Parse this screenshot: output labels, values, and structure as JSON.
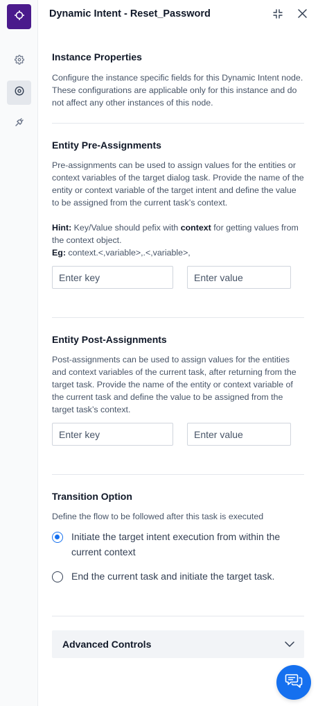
{
  "header": {
    "title": "Dynamic Intent - Reset_Password"
  },
  "rail": {
    "items": [
      {
        "icon": "settings-gear-icon"
      },
      {
        "icon": "target-circle-icon",
        "active": true
      },
      {
        "icon": "plug-icon"
      }
    ]
  },
  "instance": {
    "title": "Instance Properties",
    "description": "Configure the instance specific fields for this Dynamic Intent node. These configurations are applicable only for this instance and do not affect any other instances of this node."
  },
  "pre": {
    "title": "Entity Pre-Assignments",
    "description": "Pre-assignments can be used to assign values for the entities or context variables of the target dialog task. Provide the name of the entity or context variable of the target intent and define the value to be assigned from the current task’s context.",
    "hint_label": "Hint:",
    "hint_text_1": " Key/Value should pefix with ",
    "hint_keyword": "context",
    "hint_text_2": " for getting values from the context object.",
    "eg_label": "Eg:",
    "eg_text": " context.<,variable>,.<,variable>,",
    "key_placeholder": "Enter key",
    "value_placeholder": "Enter value"
  },
  "post": {
    "title": "Entity Post-Assignments",
    "description": "Post-assignments can be used to assign values for the entities and context variables of the current task, after returning from the target task. Provide the name of the entity or context variable of the current task and define the value to be assigned from the target task’s context.",
    "key_placeholder": "Enter key",
    "value_placeholder": "Enter value"
  },
  "transition": {
    "title": "Transition Option",
    "description": "Define the flow to be followed after this task is executed",
    "options": [
      {
        "label": "Initiate the target intent execution from within the current context",
        "selected": true
      },
      {
        "label": "End the current task and initiate the target task.",
        "selected": false
      }
    ]
  },
  "advanced": {
    "label": "Advanced Controls"
  },
  "colors": {
    "brand": "#4a1a8c",
    "accent": "#1570ef"
  }
}
